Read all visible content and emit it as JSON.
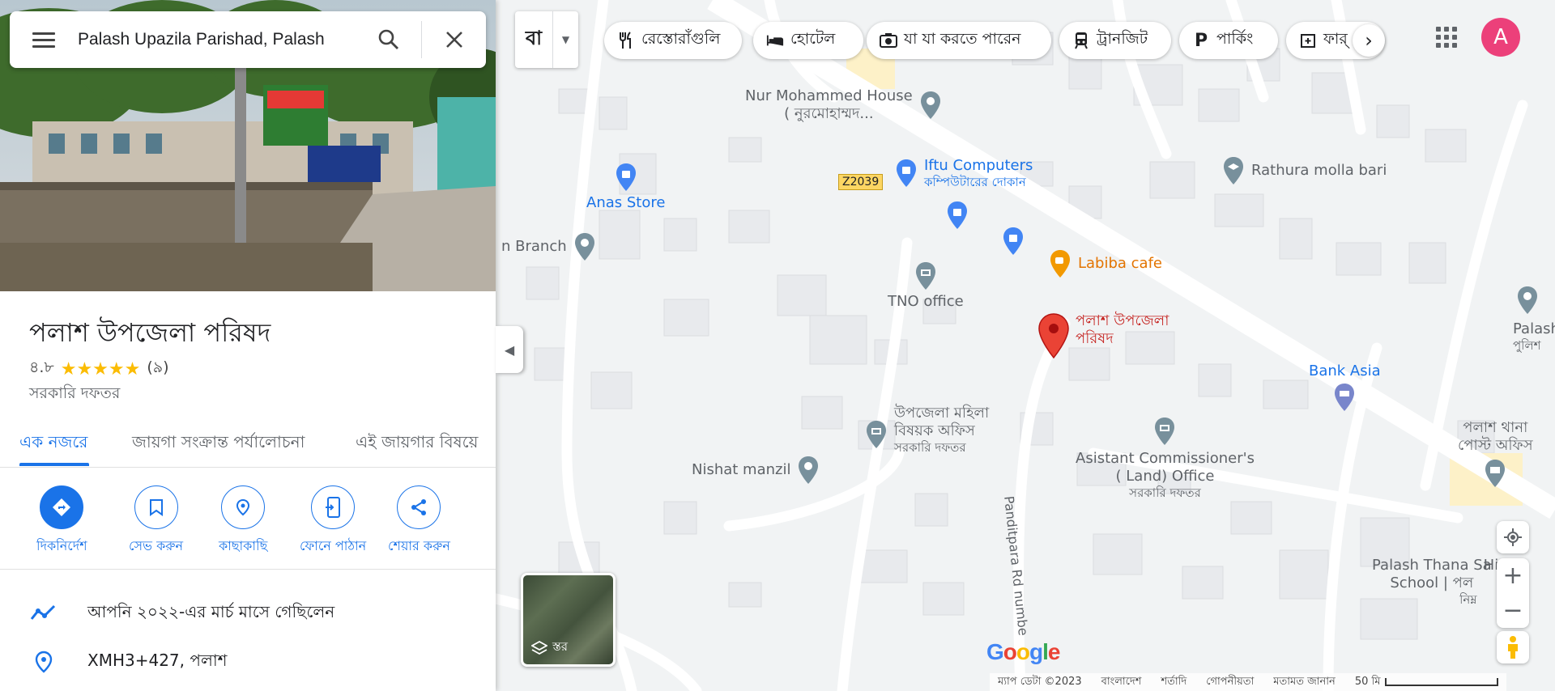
{
  "search": {
    "value": "Palash Upazila Parishad, Palash",
    "menu_icon": "hamburger-menu-icon",
    "search_icon": "search-icon",
    "close_icon": "close-icon"
  },
  "place": {
    "title": "পলাশ উপজেলা পরিষদ",
    "rating": "৪.৮",
    "stars": 5,
    "review_count": "(৯)",
    "category": "সরকারি দফতর"
  },
  "tabs": [
    {
      "label": "এক নজরে",
      "active": true
    },
    {
      "label": "জায়গা সংক্রান্ত পর্যালোচনা",
      "active": false
    },
    {
      "label": "এই জায়গার বিষয়ে",
      "active": false
    }
  ],
  "actions": [
    {
      "label": "দিকনির্দেশ",
      "icon": "directions-icon"
    },
    {
      "label": "সেভ করুন",
      "icon": "bookmark-icon"
    },
    {
      "label": "কাছাকাছি",
      "icon": "nearby-icon"
    },
    {
      "label": "ফোনে পাঠান",
      "icon": "send-to-phone-icon"
    },
    {
      "label": "শেয়ার করুন",
      "icon": "share-icon"
    }
  ],
  "info": {
    "visited": "আপনি ২০২২-এর মার্চ মাসে গেছিলেন",
    "plus_code": "XMH3+427, পলাশ"
  },
  "top_bar": {
    "language": "বা",
    "chips": [
      {
        "label": "রেস্তোরাঁগুলি",
        "icon": "restaurant-icon"
      },
      {
        "label": "হোটেল",
        "icon": "hotel-icon"
      },
      {
        "label": "যা যা করতে পারেন",
        "icon": "camera-icon"
      },
      {
        "label": "ট্রানজিট",
        "icon": "transit-icon"
      },
      {
        "label": "পার্কিং",
        "icon": "parking-icon"
      },
      {
        "label": "ফার্",
        "icon": "pharmacy-icon"
      }
    ],
    "avatar_letter": "A",
    "avatar_color": "#ec407a"
  },
  "map": {
    "road_shield": "Z2039",
    "road_name": "Panditpara Rd numbe",
    "pois": {
      "nur_house": {
        "name": "Nur Mohammed House",
        "sub": "( নুরমোহাম্মদ..."
      },
      "iftu": {
        "name": "Iftu Computers",
        "sub": "কম্পিউটারের দোকান"
      },
      "rathura": {
        "name": "Rathura molla bari"
      },
      "anas": {
        "name": "Anas Store"
      },
      "branch": {
        "name": "n Branch"
      },
      "labiba": {
        "name": "Labiba cafe"
      },
      "tno": {
        "name": "TNO office"
      },
      "selected": {
        "name_line1": "পলাশ উপজেলা",
        "name_line2": "পরিষদ"
      },
      "palash_police": {
        "name": "Palash",
        "sub": "পুলিশ"
      },
      "bank_asia": {
        "name": "Bank Asia"
      },
      "mohila": {
        "name_line1": "উপজেলা মহিলা",
        "name_line2": "বিষয়ক অফিস",
        "sub": "সরকারি দফতর"
      },
      "nishat": {
        "name": "Nishat manzil"
      },
      "ac_land": {
        "name_line1": "Asistant Commissioner's",
        "name_line2": "( Land) Office",
        "sub": "সরকারি দফতর"
      },
      "post_office": {
        "name_line1": "পলাশ থানা",
        "name_line2": "পোস্ট অফিস"
      },
      "school": {
        "name_line1": "Palash Thana Sa",
        "name_line2": "School | পল",
        "suffix": "High",
        "sub": "নিম্ন"
      }
    },
    "layer_label": "স্তর",
    "google_logo": "Google",
    "footer": {
      "map_data": "ম্যাপ ডেটা ©2023",
      "country": "বাংলাদেশ",
      "terms": "শর্তাদি",
      "privacy": "গোপনীয়তা",
      "feedback": "মতামত জানান",
      "scale": "50 মি"
    }
  },
  "colors": {
    "accent": "#1a73e8",
    "pin_red": "#ea4335",
    "star": "#fbbc04",
    "map_bg": "#f1f3f4"
  }
}
